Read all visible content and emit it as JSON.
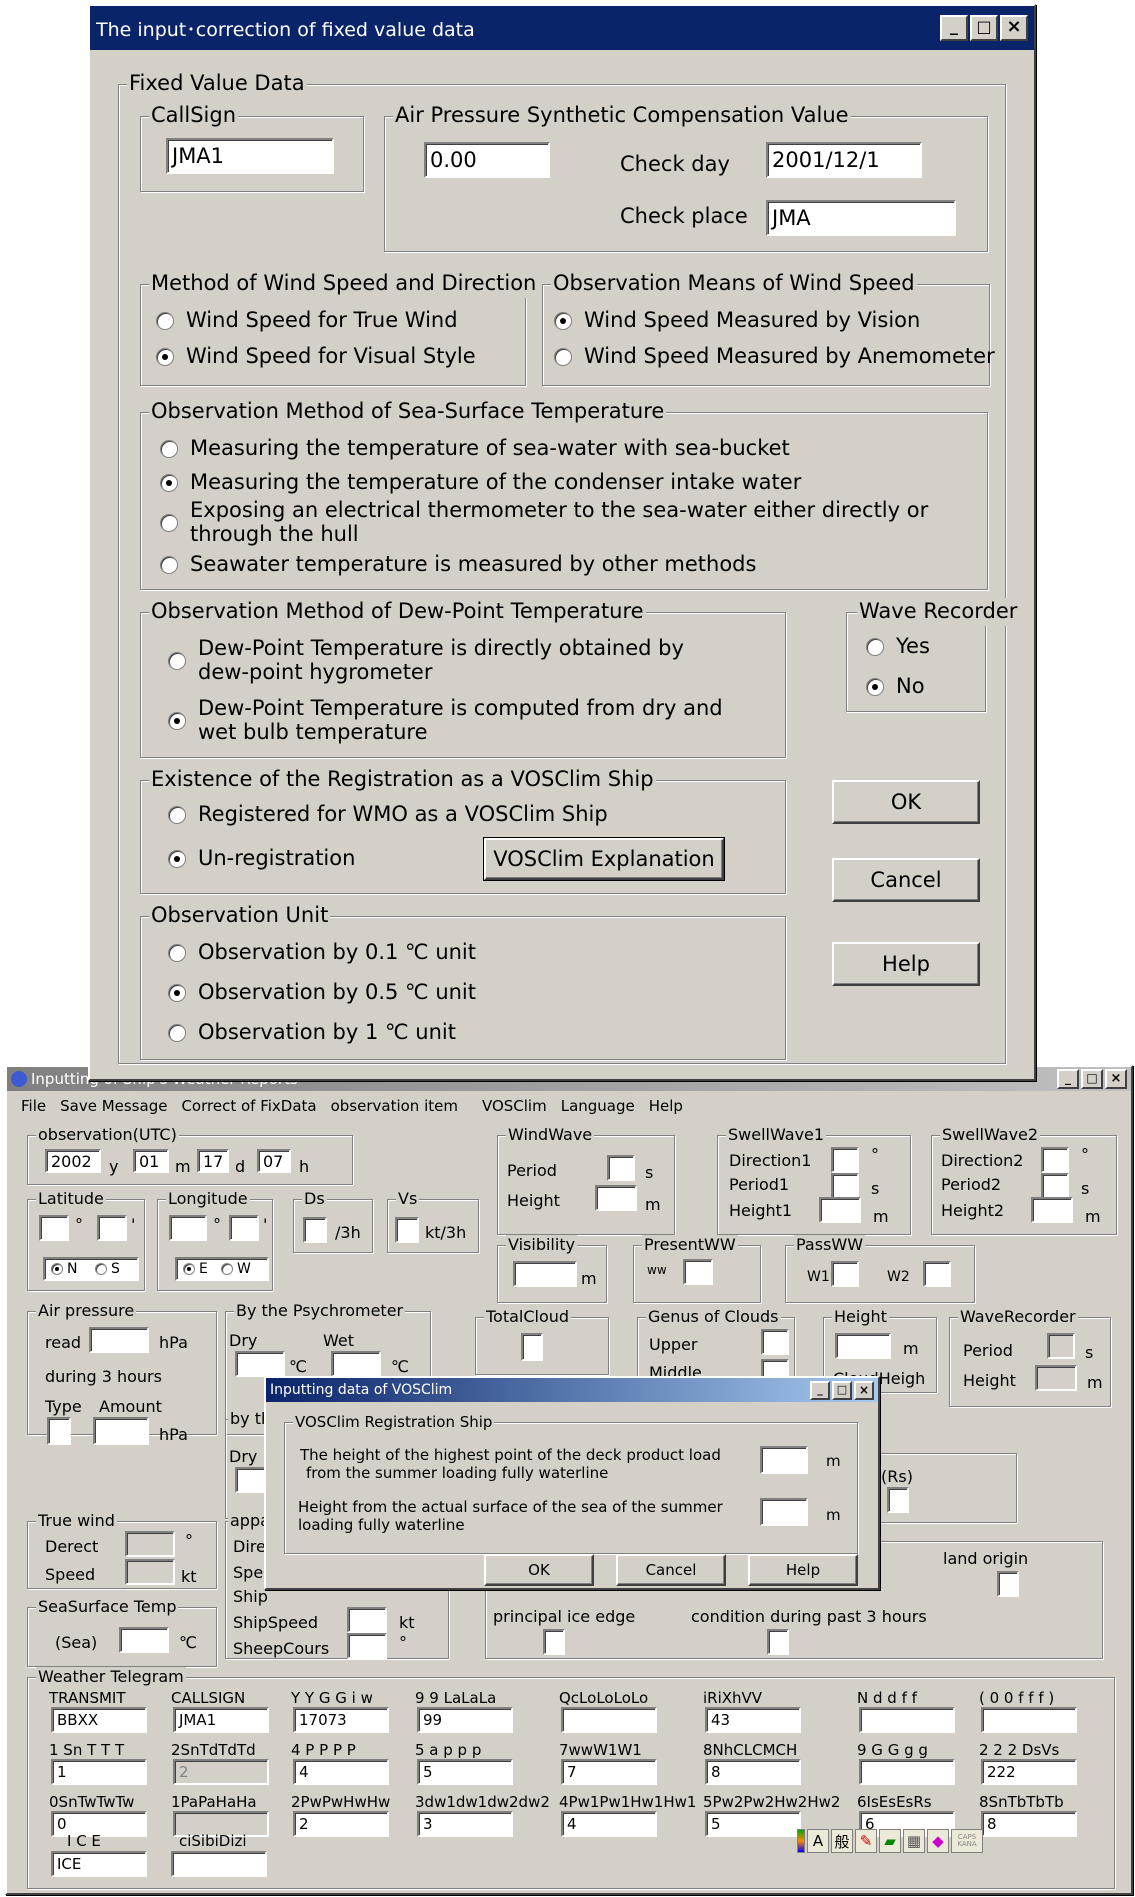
{
  "fixdlg": {
    "title": "The input･correction of fixed value data",
    "fixed_group": "Fixed Value Data",
    "callsign_group": "CallSign",
    "callsign_value": "JMA1",
    "air_group": "Air Pressure Synthetic Compensation Value",
    "air_value": "0.00",
    "check_day_label": "Check day",
    "check_day_value": "2001/12/1",
    "check_place_label": "Check place",
    "check_place_value": "JMA",
    "wind_method_group": "Method of Wind Speed and Direction",
    "wind_true": "Wind Speed for True Wind",
    "wind_visual": "Wind Speed for Visual Style",
    "wind_means_group": "Observation Means of Wind Speed",
    "means_vision": "Wind Speed Measured by Vision",
    "means_anemometer": "Wind Speed Measured by Anemometer",
    "sst_group": "Observation Method of Sea-Surface Temperature",
    "sst_bucket": "Measuring the temperature of sea-water with sea-bucket",
    "sst_intake": "Measuring the temperature of the condenser intake water",
    "sst_hull_1": "Exposing an electrical thermometer to the sea-water either directly or",
    "sst_hull_2": "through the hull",
    "sst_other": "Seawater temperature is measured by other methods",
    "dew_group": "Observation Method of Dew-Point Temperature",
    "dew_direct_1": "Dew-Point Temperature is directly obtained by",
    "dew_direct_2": "dew-point hygrometer",
    "dew_computed_1": "Dew-Point Temperature is computed from dry and",
    "dew_computed_2": "wet bulb temperature",
    "wave_group": "Wave Recorder",
    "wave_yes": "Yes",
    "wave_no": "No",
    "vos_group": "Existence of the Registration as a VOSClim Ship",
    "vos_registered": "Registered for WMO as a VOSClim Ship",
    "vos_unregistered": "Un-registration",
    "vos_explain_btn": "VOSClim Explanation",
    "ok": "OK",
    "cancel": "Cancel",
    "help": "Help",
    "unit_group": "Observation Unit",
    "unit_01": "Observation by 0.1 ℃ unit",
    "unit_05": "Observation by 0.5 ℃ unit",
    "unit_1": "Observation by 1 ℃ unit"
  },
  "main": {
    "title": "Inputting of Ship's Weather Reports",
    "menu": [
      "File",
      "Save Message",
      "Correct of FixData",
      "observation item",
      "VOSClim",
      "Language",
      "Help"
    ],
    "obs_group": "observation(UTC)",
    "year": "2002",
    "y": "y",
    "month": "01",
    "m": "m",
    "day": "17",
    "d": "d",
    "hour": "07",
    "h": "h",
    "latitude": "Latitude",
    "longitude": "Longitude",
    "ds": "Ds",
    "vs": "Vs",
    "deg": "°",
    "min": "'",
    "per3h": "/3h",
    "kt3h": "kt/3h",
    "n": "N",
    "s": "S",
    "e": "E",
    "w": "W",
    "windwave": "WindWave",
    "period": "Period",
    "height": "Height",
    "sec": "s",
    "meter": "m",
    "swell1": "SwellWave1",
    "direction1": "Direction1",
    "period1": "Period1",
    "height1": "Height1",
    "swell2": "SwellWave2",
    "direction2": "Direction2",
    "period2": "Period2",
    "height2": "Height2",
    "visibility": "Visibility",
    "presentww": "PresentWW",
    "ww": "ww",
    "passww": "PassWW",
    "w1": "W1",
    "w2": "W2",
    "air_pressure": "Air pressure",
    "read": "read",
    "hpa": "hPa",
    "during3": "during 3 hours",
    "type": "Type",
    "amount": "Amount",
    "psychro": "By the  Psychrometer",
    "dry": "Dry",
    "wet": "Wet",
    "degc": "℃",
    "totalcloud": "TotalCloud",
    "genus": "Genus of Clouds",
    "upper": "Upper",
    "middle": "Middle",
    "height_grp": "Height",
    "cloud_heigh": "CloudHeigh",
    "waverec": "WaveRecorder",
    "by_th": "by th",
    "dry2": "Dry",
    "rs": "(Rs)",
    "truewind": "True wind",
    "derect": "Derect",
    "speed": "Speed",
    "kt": "kt",
    "appa": "appa",
    "dire": "Dire",
    "spe": "Spe",
    "ship": "Ship",
    "shipspeed": "ShipSpeed",
    "sheepcours": "SheepCours",
    "land_origin": "land origin",
    "principal_ice": "principal ice edge",
    "condition_3h": "condition during past 3 hours",
    "sst": "SeaSurface Temp",
    "sea": "(Sea)",
    "telegram": "Weather Telegram",
    "tg": [
      {
        "l": "TRANSMIT",
        "v": "BBXX"
      },
      {
        "l": "CALLSIGN",
        "v": "JMA1"
      },
      {
        "l": "Y Y G G i w",
        "v": "17073"
      },
      {
        "l": "9 9 LaLaLa",
        "v": "99"
      },
      {
        "l": "QcLoLoLoLo",
        "v": ""
      },
      {
        "l": "iRiXhVV",
        "v": "43"
      },
      {
        "l": "N d d f f",
        "v": ""
      },
      {
        "l": "( 0 0 f f f )",
        "v": ""
      },
      {
        "l": "1 Sn T T T",
        "v": "1"
      },
      {
        "l": "2SnTdTdTd",
        "v": "2"
      },
      {
        "l": "4 P P P P",
        "v": "4"
      },
      {
        "l": "5 a p p p",
        "v": "5"
      },
      {
        "l": "7wwW1W1",
        "v": "7"
      },
      {
        "l": "8NhCLCMCH",
        "v": "8"
      },
      {
        "l": "9 G G g g",
        "v": ""
      },
      {
        "l": "2 2 2 DsVs",
        "v": "222"
      },
      {
        "l": "0SnTwTwTw",
        "v": "0"
      },
      {
        "l": "1PaPaHaHa",
        "v": ""
      },
      {
        "l": "2PwPwHwHw",
        "v": "2"
      },
      {
        "l": "3dw1dw1dw2dw2",
        "v": "3"
      },
      {
        "l": "4Pw1Pw1Hw1Hw1",
        "v": "4"
      },
      {
        "l": "5Pw2Pw2Hw2Hw2",
        "v": "5"
      },
      {
        "l": "6IsEsEsRs",
        "v": "6"
      },
      {
        "l": "8SnTbTbTb",
        "v": "8"
      }
    ],
    "ice_label": "I C E",
    "ice_value": "ICE",
    "ci_label": "ciSibiDizi",
    "ci_value": ""
  },
  "vosdlg": {
    "title": "Inputting data of VOSClim",
    "group": "VOSClim Registration Ship",
    "q1_1": "The height of the highest point of the deck product load",
    "q1_2": "from the summer loading fully waterline",
    "q2_1": "Height from the actual surface of the sea of the summer",
    "q2_2": "loading fully waterline",
    "m": "m",
    "ok": "OK",
    "cancel": "Cancel",
    "help": "Help"
  },
  "ime": {
    "a": "A",
    "kanji": "般",
    "caps": "CAPS KANA"
  }
}
